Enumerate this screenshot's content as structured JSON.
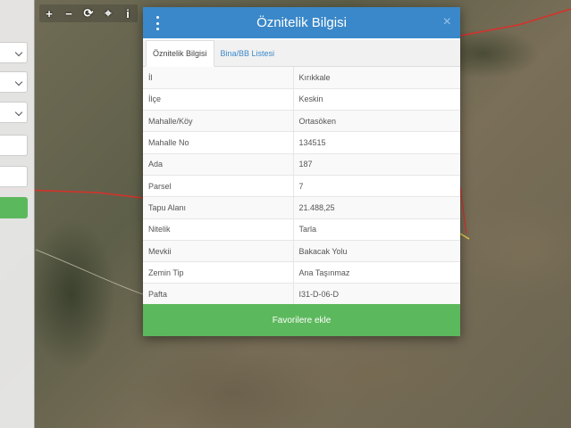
{
  "toolbar": [
    {
      "name": "zoom-in-button",
      "glyph": "+"
    },
    {
      "name": "zoom-out-button",
      "glyph": "−"
    },
    {
      "name": "refresh-button",
      "glyph": "⟳"
    },
    {
      "name": "locate-button",
      "glyph": "⌖"
    },
    {
      "name": "info-button",
      "glyph": "i"
    }
  ],
  "modal": {
    "title": "Öznitelik Bilgisi",
    "close": "×",
    "tabs": [
      "Öznitelik Bilgisi",
      "Bina/BB Listesi"
    ],
    "rows": [
      {
        "key": "İl",
        "value": "Kırıkkale"
      },
      {
        "key": "İlçe",
        "value": "Keskin"
      },
      {
        "key": "Mahalle/Köy",
        "value": "Ortasöken"
      },
      {
        "key": "Mahalle No",
        "value": "134515"
      },
      {
        "key": "Ada",
        "value": "187"
      },
      {
        "key": "Parsel",
        "value": "7"
      },
      {
        "key": "Tapu Alanı",
        "value": "21.488,25"
      },
      {
        "key": "Nitelik",
        "value": "Tarla"
      },
      {
        "key": "Mevkii",
        "value": "Bakacak Yolu"
      },
      {
        "key": "Zemin Tip",
        "value": "Ana Taşınmaz"
      },
      {
        "key": "Pafta",
        "value": "I31-D-06-D"
      }
    ],
    "favorite_button": "Favorilere ekle"
  },
  "colors": {
    "header": "#3a88c9",
    "button": "#5cb85c",
    "parcel_line": "#d9302a"
  }
}
